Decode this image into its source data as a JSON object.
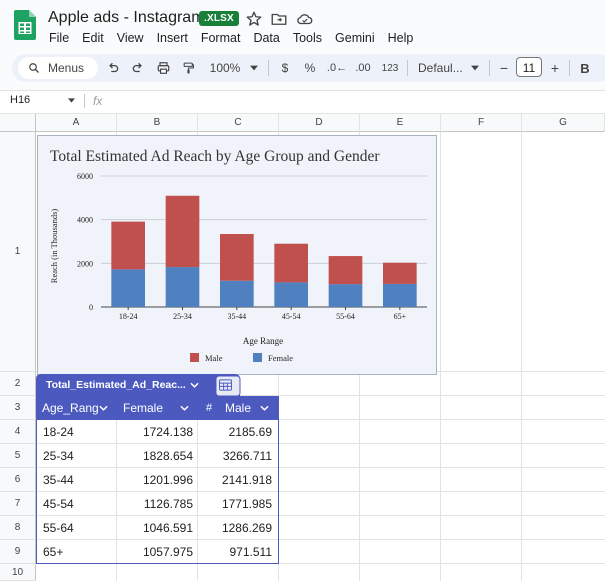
{
  "app": {
    "title": "Apple ads - Instagram",
    "badge": ".XLSX",
    "menus": [
      "File",
      "Edit",
      "View",
      "Insert",
      "Format",
      "Data",
      "Tools",
      "Gemini",
      "Help"
    ]
  },
  "toolbar": {
    "search_label": "Menus",
    "zoom": "100%",
    "currency": "$",
    "percent": "%",
    "dec_decrease": ".0←",
    "dec_increase": ".00",
    "number_format": "123",
    "font": "Defaul...",
    "font_size": "11",
    "minus": "−",
    "plus": "+",
    "bold": "B"
  },
  "formula_bar": {
    "cell_ref": "H16",
    "fx": "fx"
  },
  "columns": [
    "A",
    "B",
    "C",
    "D",
    "E",
    "F",
    "G"
  ],
  "rows": [
    "1",
    "2",
    "3",
    "4",
    "5",
    "6",
    "7",
    "8",
    "9",
    "10"
  ],
  "chart_data": {
    "type": "bar",
    "stacked": true,
    "title": "Total Estimated Ad Reach by Age Group and Gender",
    "xlabel": "Age Range",
    "ylabel": "Reach (in Thousands)",
    "categories": [
      "18-24",
      "25-34",
      "35-44",
      "45-54",
      "55-64",
      "65+"
    ],
    "series": [
      {
        "name": "Female",
        "color": "#4f81c0",
        "values": [
          1724.138,
          1828.654,
          1201.996,
          1126.785,
          1046.591,
          1057.975
        ]
      },
      {
        "name": "Male",
        "color": "#c0504d",
        "values": [
          2185.69,
          3266.711,
          2141.918,
          1771.985,
          1286.269,
          971.511
        ]
      }
    ],
    "ylim": [
      0,
      6000
    ],
    "yticks": [
      "0",
      "2000",
      "4000",
      "6000"
    ],
    "legend": [
      "Male",
      "Female"
    ],
    "legend_position": "bottom",
    "grid": true
  },
  "table": {
    "name": "Total_Estimated_Ad_Reac...",
    "headers": [
      "Age_Rang",
      "Female",
      "Male"
    ],
    "rows": [
      [
        "18-24",
        "1724.138",
        "2185.69"
      ],
      [
        "25-34",
        "1828.654",
        "3266.711"
      ],
      [
        "35-44",
        "1201.996",
        "2141.918"
      ],
      [
        "45-54",
        "1126.785",
        "1771.985"
      ],
      [
        "55-64",
        "1046.591",
        "1286.269"
      ],
      [
        "65+",
        "1057.975",
        "971.511"
      ]
    ]
  }
}
